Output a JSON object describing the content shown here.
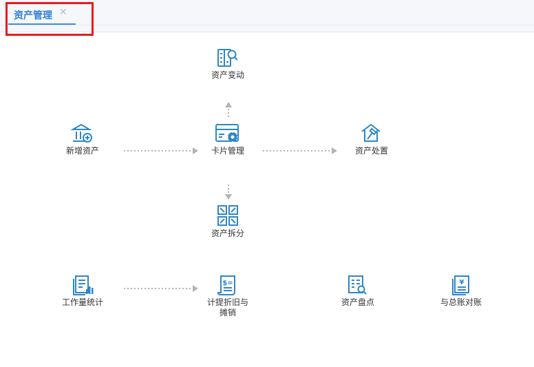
{
  "tab": {
    "label": "资产管理",
    "close_glyph": "✕"
  },
  "nodes": {
    "asset_change": "资产变动",
    "new_asset": "新增资产",
    "card_management": "卡片管理",
    "asset_disposal": "资产处置",
    "asset_split": "资产拆分",
    "workload_stats": "工作量统计",
    "depreciation": "计提折旧与摊销",
    "asset_inventory": "资产盘点",
    "ledger_reconcile": "与总账对账"
  },
  "colors": {
    "icon_blue": "#2e86c7",
    "tab_blue": "#2f7fd8",
    "highlight_red": "#e51c1c",
    "arrow_gray": "#b3b3b3"
  }
}
